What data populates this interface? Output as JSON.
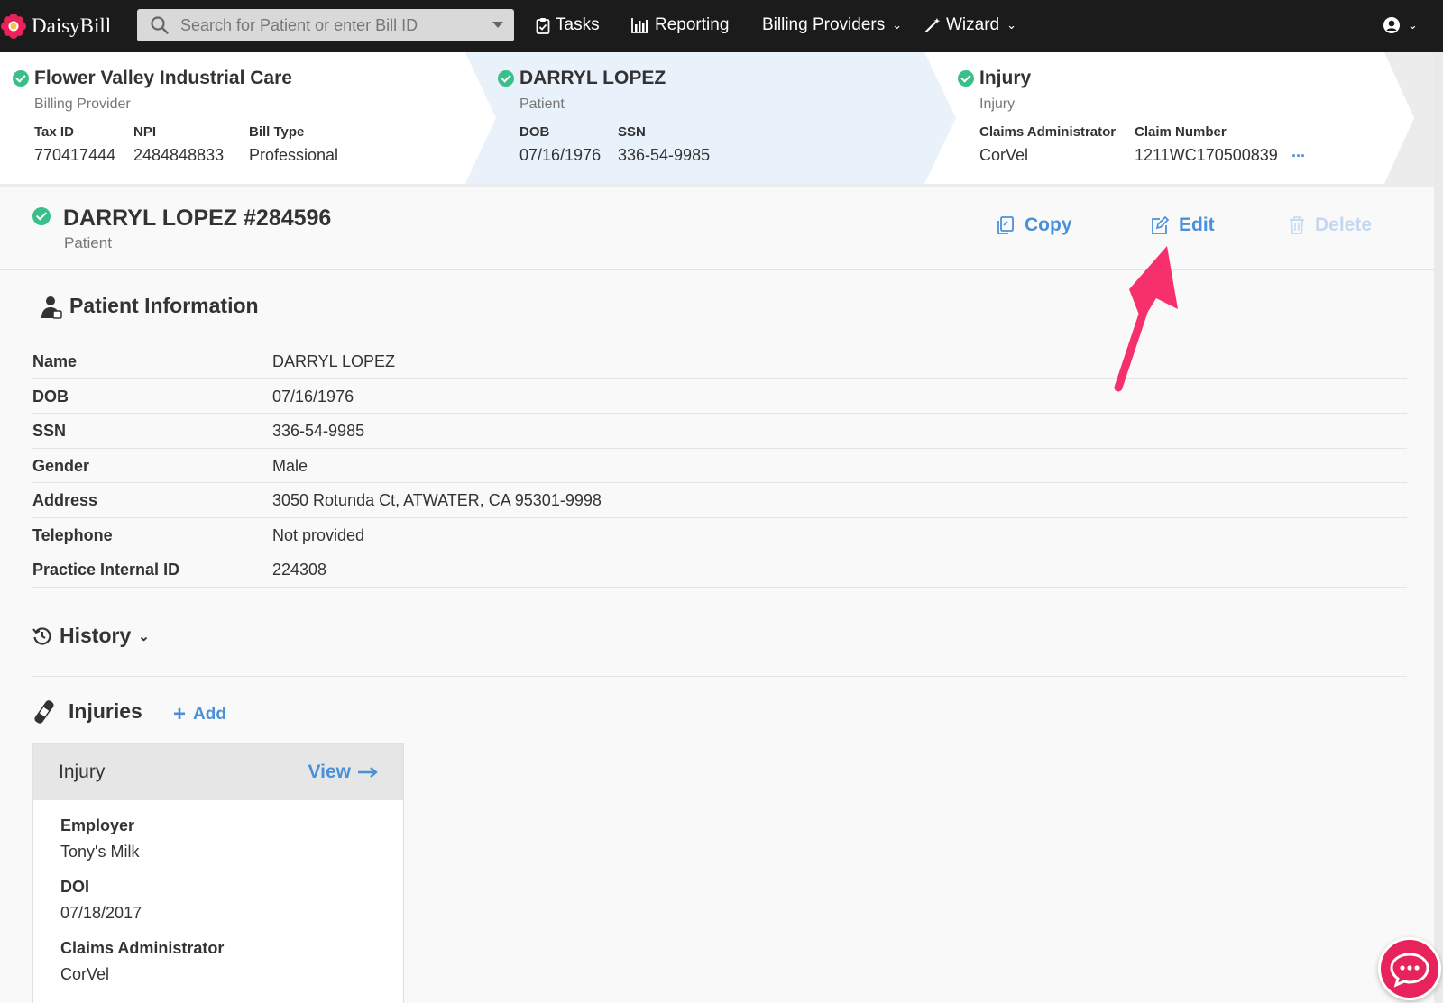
{
  "app": {
    "logo_text": "DaisyBill",
    "search_placeholder": "Search for Patient or enter Bill ID",
    "nav": {
      "tasks": "Tasks",
      "reporting": "Reporting",
      "billing_providers": "Billing Providers",
      "wizard": "Wizard"
    }
  },
  "breadcrumbs": {
    "provider": {
      "title": "Flower Valley Industrial Care",
      "subtitle": "Billing Provider",
      "fields": [
        {
          "label": "Tax ID",
          "value": "770417444"
        },
        {
          "label": "NPI",
          "value": "2484848833"
        },
        {
          "label": "Bill Type",
          "value": "Professional"
        }
      ]
    },
    "patient": {
      "title": "DARRYL LOPEZ",
      "subtitle": "Patient",
      "fields": [
        {
          "label": "DOB",
          "value": "07/16/1976"
        },
        {
          "label": "SSN",
          "value": "336-54-9985"
        }
      ]
    },
    "injury": {
      "title": "Injury",
      "subtitle": "Injury",
      "fields": [
        {
          "label": "Claims Administrator",
          "value": "CorVel"
        },
        {
          "label": "Claim Number",
          "value": "1211WC170500839"
        }
      ],
      "more": "..."
    }
  },
  "header": {
    "title": "DARRYL LOPEZ #284596",
    "subtitle": "Patient",
    "actions": {
      "copy": "Copy",
      "edit": "Edit",
      "delete": "Delete"
    }
  },
  "patient_info": {
    "title": "Patient Information",
    "rows": [
      {
        "label": "Name",
        "value": "DARRYL LOPEZ"
      },
      {
        "label": "DOB",
        "value": "07/16/1976"
      },
      {
        "label": "SSN",
        "value": "336-54-9985"
      },
      {
        "label": "Gender",
        "value": "Male"
      },
      {
        "label": "Address",
        "value": "3050 Rotunda Ct, ATWATER, CA 95301-9998"
      },
      {
        "label": "Telephone",
        "value": "Not provided"
      },
      {
        "label": "Practice Internal ID",
        "value": "224308"
      }
    ]
  },
  "history": {
    "title": "History"
  },
  "injuries": {
    "title": "Injuries",
    "add_label": "Add",
    "card": {
      "title": "Injury",
      "view_label": "View",
      "fields": [
        {
          "label": "Employer",
          "value": "Tony's Milk"
        },
        {
          "label": "DOI",
          "value": "07/18/2017"
        },
        {
          "label": "Claims Administrator",
          "value": "CorVel"
        }
      ]
    }
  },
  "colors": {
    "accent": "#4a90d9",
    "success": "#3bbf8a",
    "annotation": "#f5306a",
    "chat": "#e8225a"
  },
  "icons": [
    "daisy-logo-icon",
    "search-icon",
    "clipboard-check-icon",
    "bar-chart-icon",
    "magic-wand-icon",
    "user-circle-icon",
    "copy-icon",
    "edit-icon",
    "trash-icon",
    "patient-icon",
    "history-icon",
    "bandage-icon",
    "plus-icon",
    "arrow-right-icon",
    "chat-icon"
  ]
}
